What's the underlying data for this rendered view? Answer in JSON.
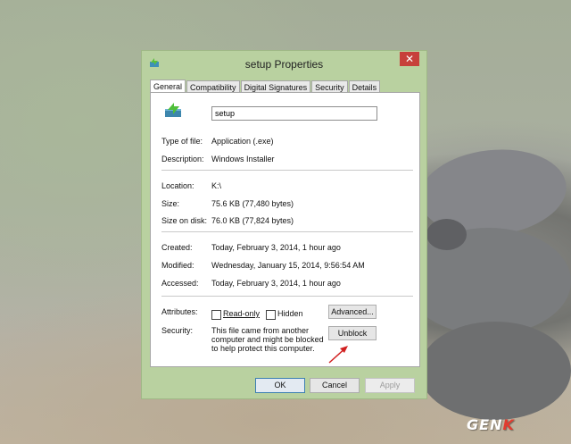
{
  "window": {
    "title": "setup Properties",
    "close_label": "✕"
  },
  "tabs": [
    {
      "label": "General",
      "active": true
    },
    {
      "label": "Compatibility"
    },
    {
      "label": "Digital Signatures"
    },
    {
      "label": "Security"
    },
    {
      "label": "Details"
    }
  ],
  "general": {
    "file_name": "setup",
    "type_label": "Type of file:",
    "type_value": "Application (.exe)",
    "description_label": "Description:",
    "description_value": "Windows Installer",
    "location_label": "Location:",
    "location_value": "K:\\",
    "size_label": "Size:",
    "size_value": "75.6 KB (77,480 bytes)",
    "size_on_disk_label": "Size on disk:",
    "size_on_disk_value": "76.0 KB (77,824 bytes)",
    "created_label": "Created:",
    "created_value": "Today, February 3, 2014, 1 hour ago",
    "modified_label": "Modified:",
    "modified_value": "Wednesday, January 15, 2014, 9:56:54 AM",
    "accessed_label": "Accessed:",
    "accessed_value": "Today, February 3, 2014, 1 hour ago",
    "attributes_label": "Attributes:",
    "readonly_label": "Read-only",
    "readonly_checked": false,
    "hidden_label": "Hidden",
    "hidden_checked": false,
    "advanced_label": "Advanced...",
    "security_label": "Security:",
    "security_text": "This file came from another computer and might be blocked to help protect this computer.",
    "unblock_label": "Unblock"
  },
  "footer": {
    "ok_label": "OK",
    "cancel_label": "Cancel",
    "apply_label": "Apply"
  },
  "watermark": {
    "prefix": "GEN",
    "suffix": "K"
  },
  "colors": {
    "window_frame": "#b9d1a0",
    "close_button": "#c7403a",
    "annotation_arrow": "#d12020"
  }
}
